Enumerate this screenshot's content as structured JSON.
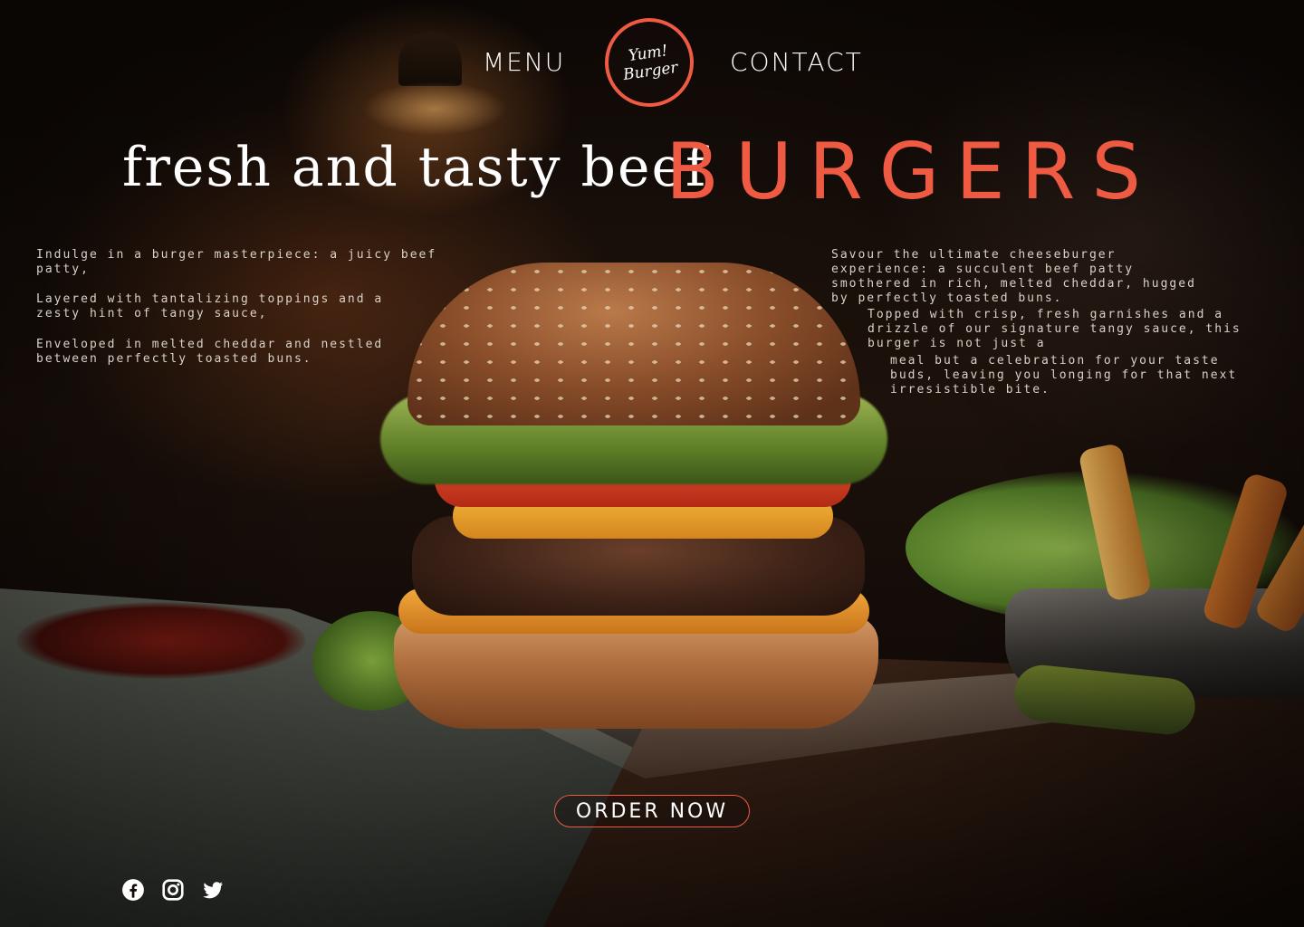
{
  "nav": {
    "menu_label": "MENU",
    "contact_label": "CONTACT",
    "logo_line1": "Yum!",
    "logo_line2": "Burger"
  },
  "hero": {
    "headline_light": "fresh and  tasty beef",
    "headline_accent": "BURGERS"
  },
  "copy_left": {
    "p1": "Indulge in a burger masterpiece: a juicy beef patty,",
    "p2": "Layered with tantalizing toppings and a zesty hint of tangy sauce,",
    "p3": "Enveloped in melted cheddar and nestled between perfectly toasted buns."
  },
  "copy_right": {
    "p1": "Savour the ultimate cheeseburger experience: a succulent beef patty smothered in rich, melted cheddar, hugged by perfectly toasted buns.",
    "p2": "Topped with crisp, fresh garnishes and a drizzle of our signature tangy sauce, this burger is not just a",
    "p3": "meal but a celebration for your taste buds, leaving you longing for that next irresistible bite."
  },
  "cta": {
    "order_label": "ORDER NOW"
  },
  "social": {
    "icons": [
      "facebook-icon",
      "instagram-icon",
      "twitter-icon"
    ]
  },
  "colors": {
    "accent": "#ef5a43",
    "text": "#ffffff",
    "body_text": "#d9d2c8",
    "background": "#0d0806"
  }
}
